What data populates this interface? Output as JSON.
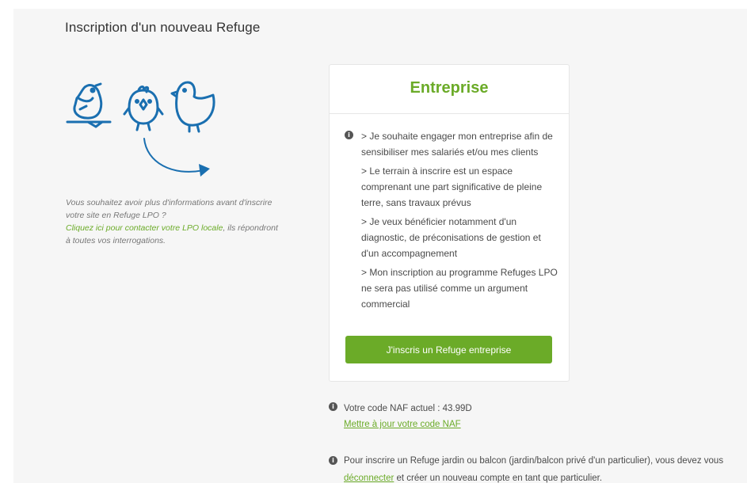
{
  "page": {
    "title": "Inscription d'un nouveau Refuge"
  },
  "icons": {
    "birds": "bird-illustrations-icon",
    "arrow": "curved-arrow-icon",
    "info": "info-circle-icon"
  },
  "info_left": {
    "line1": "Vous souhaitez avoir plus d'informations avant d'inscrire votre site en Refuge LPO ?",
    "link": "Cliquez ici pour contacter votre LPO locale",
    "line2": ", ils répondront à toutes vos interrogations."
  },
  "card": {
    "title": "Entreprise",
    "criteria": [
      "> Je souhaite engager mon entreprise afin de sensibiliser mes salariés et/ou mes clients",
      "> Le terrain à inscrire est un espace comprenant une part significative de pleine terre, sans travaux prévus",
      "> Je veux bénéficier notamment d'un diagnostic, de préconisations de gestion et d'un accompagnement",
      "> Mon inscription au programme Refuges LPO ne sera pas utilisé comme un argument commercial"
    ],
    "button_label": "J'inscris un Refuge entreprise"
  },
  "naf": {
    "text": "Votre code NAF actuel : 43.99D",
    "link": "Mettre à jour votre code NAF"
  },
  "notice": {
    "text_before": "Pour inscrire un Refuge jardin ou balcon (jardin/balcon privé d'un particulier), vous devez vous ",
    "link": "déconnecter",
    "text_after": " et créer un nouveau compte en tant que particulier."
  },
  "colors": {
    "accent_green": "#6bab28",
    "illustration_blue": "#1a6fb0",
    "background": "#f6f6f6"
  }
}
